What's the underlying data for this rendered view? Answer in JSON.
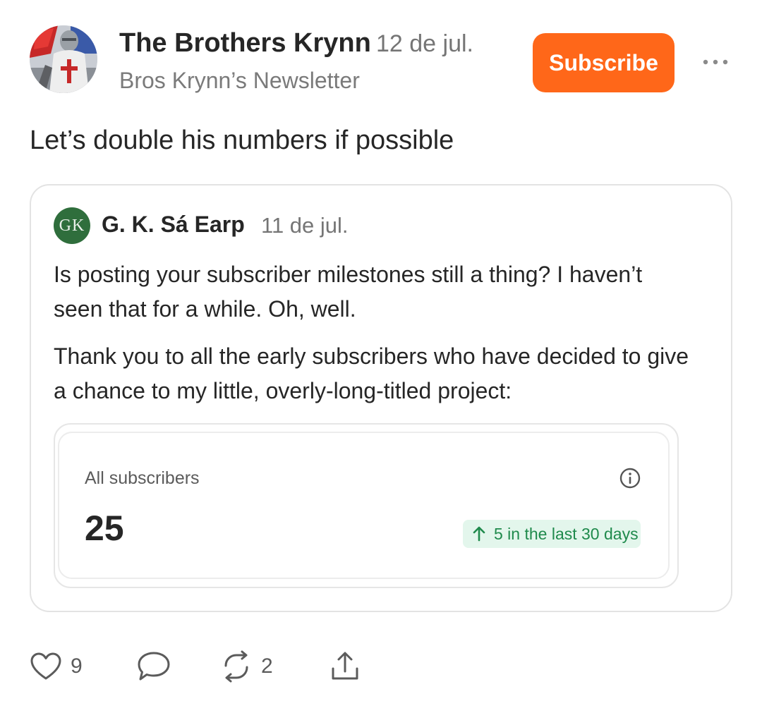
{
  "header": {
    "author_name": "The Brothers Krynn",
    "date": "12 de jul.",
    "publication": "Bros Krynn’s Newsletter",
    "subscribe_label": "Subscribe",
    "avatar_icon": "knight-templar-avatar",
    "more_icon": "more-horizontal-icon"
  },
  "post": {
    "text": "Let’s double his numbers if possible"
  },
  "quote": {
    "avatar_initials": "GK",
    "author_name": "G. K. Sá Earp",
    "date": "11 de jul.",
    "paragraphs": [
      "Is posting your subscriber milestones still a thing? I haven’t seen that for a while. Oh, well.",
      "Thank you to all the early subscribers who have decided to give a chance to my little, overly-long-titled project:"
    ],
    "stats_card": {
      "label": "All subscribers",
      "value": "25",
      "growth": "5 in the last 30 days",
      "info_icon": "info-icon",
      "growth_icon": "arrow-up-icon"
    }
  },
  "actions": {
    "likes": "9",
    "restacks": "2",
    "like_icon": "heart-icon",
    "comment_icon": "comment-icon",
    "restack_icon": "restack-icon",
    "share_icon": "share-icon"
  },
  "colors": {
    "accent": "#ff6719",
    "growth_green": "#1f8a4c",
    "growth_bg": "#e3f6ec",
    "quote_avatar": "#2f6e3c"
  }
}
